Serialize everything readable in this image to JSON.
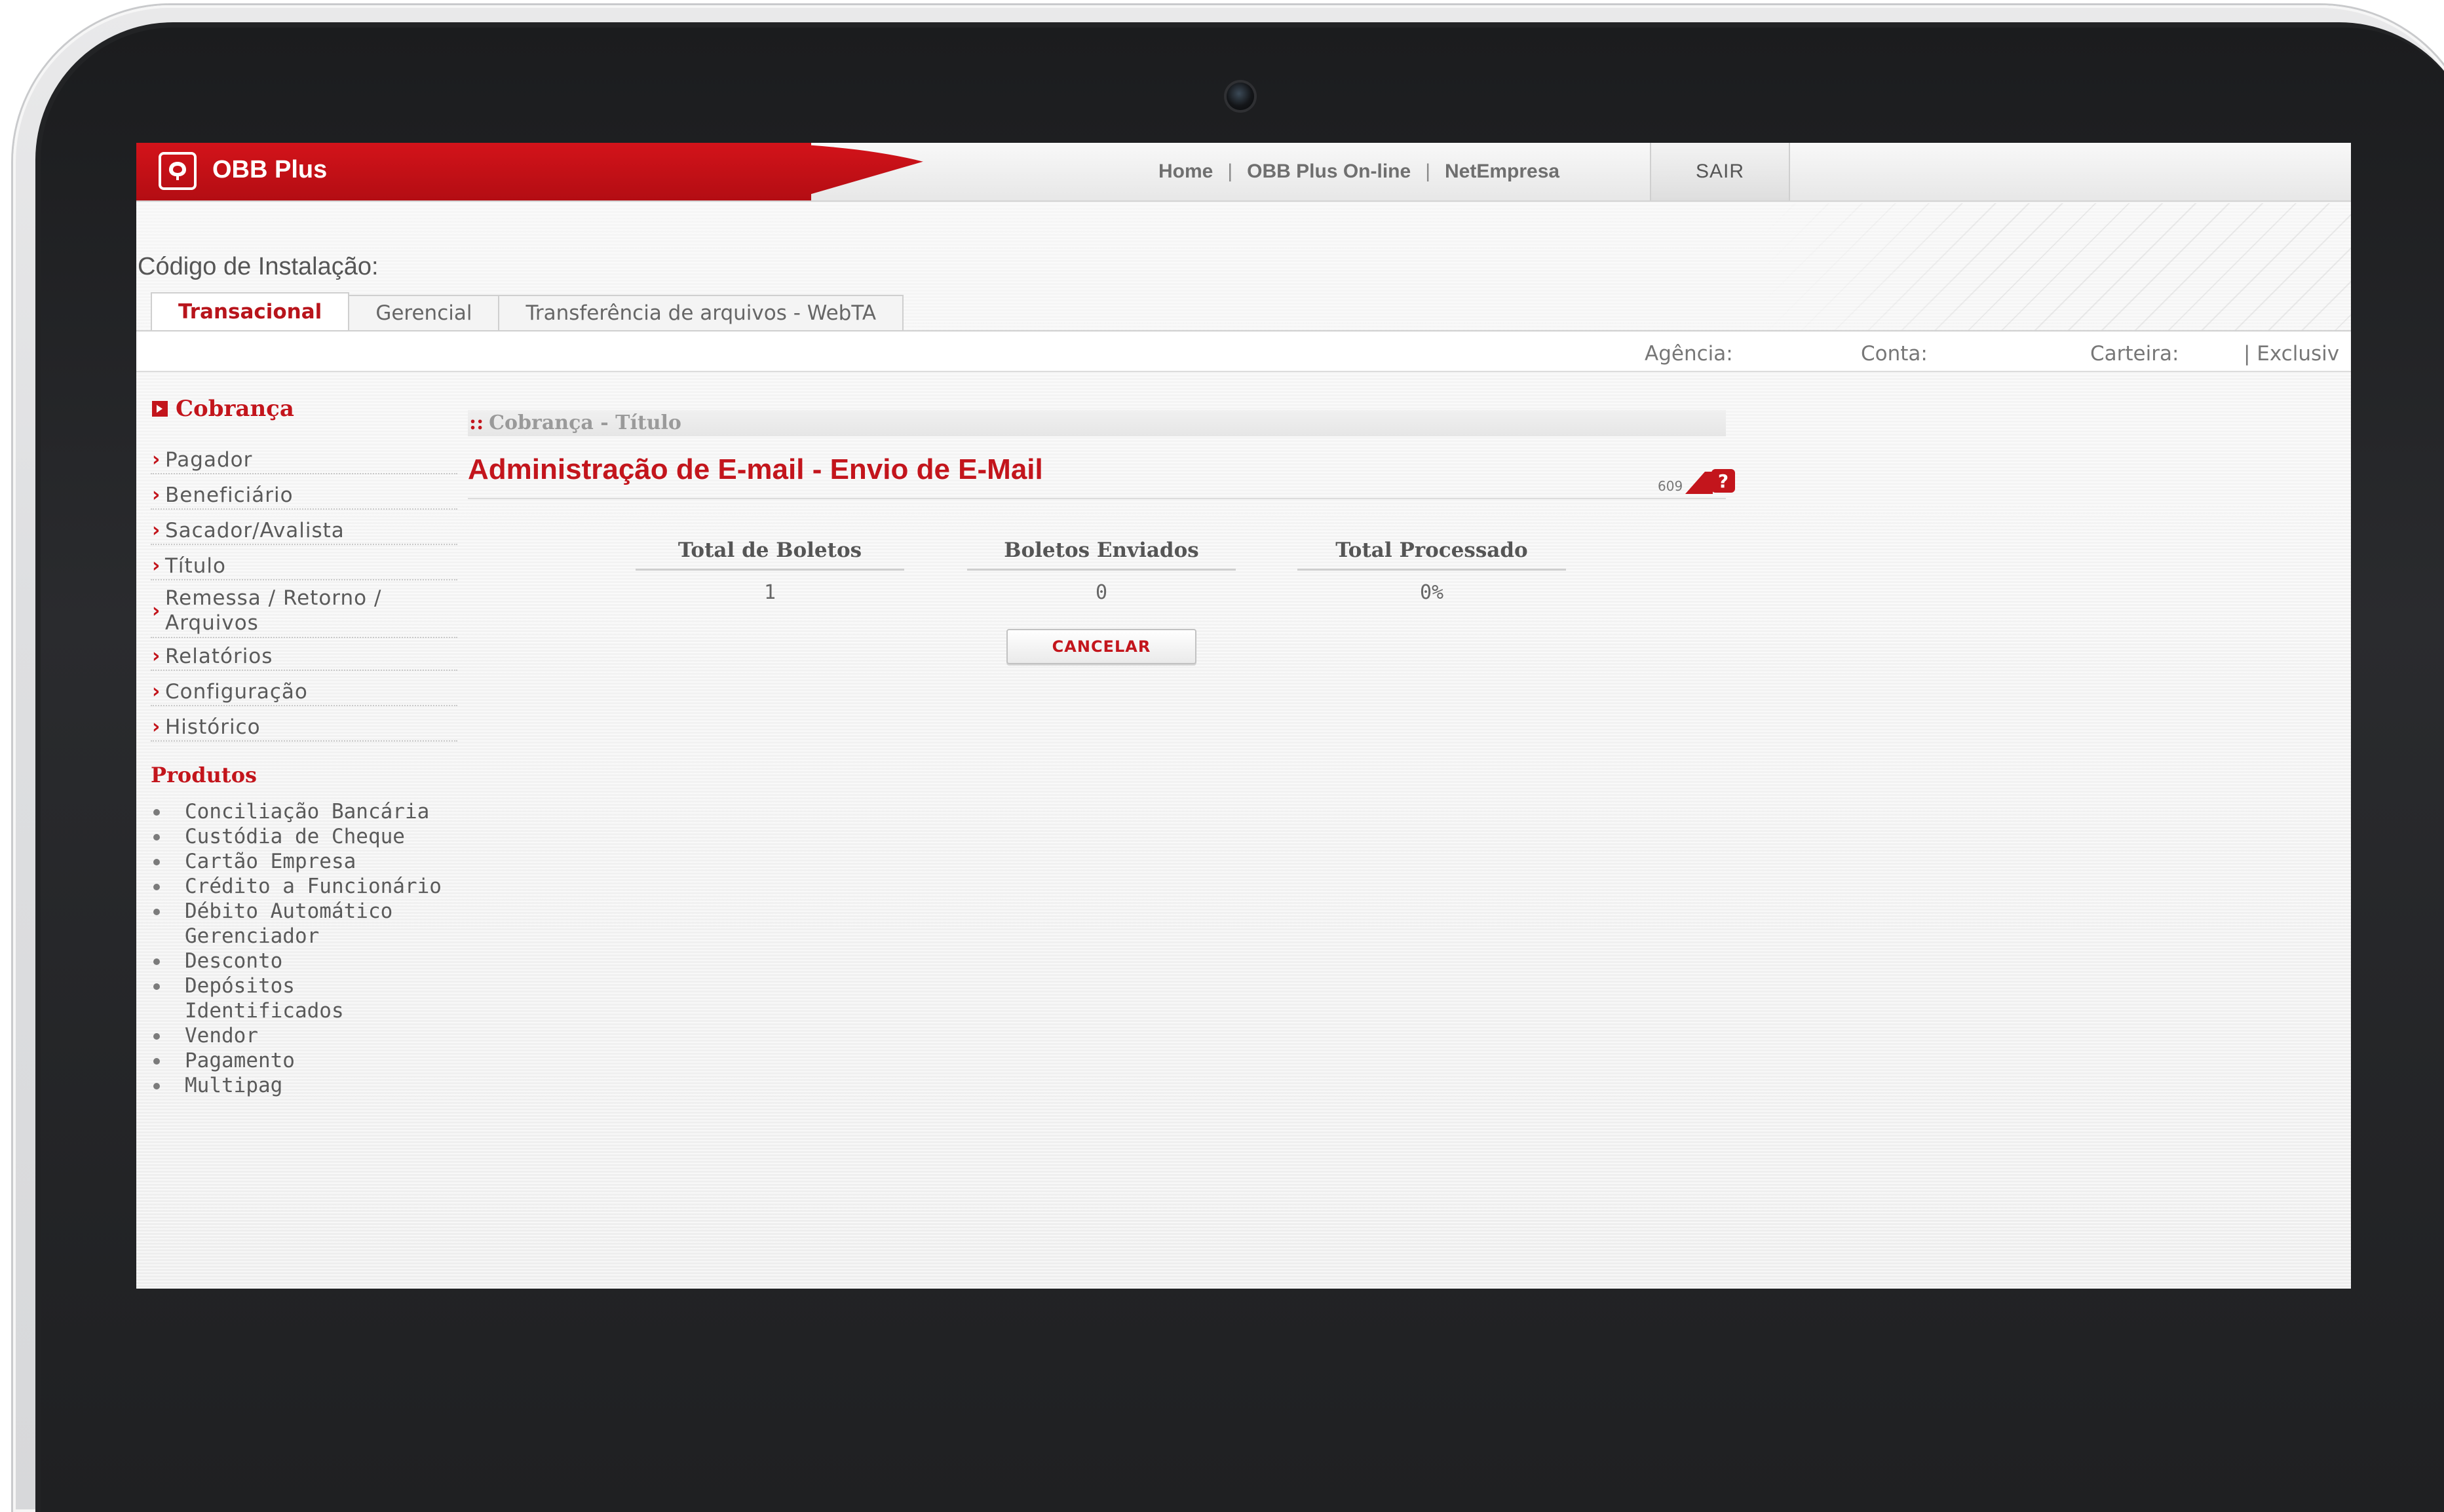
{
  "brand": {
    "name": "OBB Plus"
  },
  "topnav": {
    "items": [
      "Home",
      "OBB Plus On-line",
      "NetEmpresa"
    ],
    "separator": "|",
    "logout_label": "SAIR"
  },
  "install_code_label": "Código de Instalação:",
  "tabs": [
    {
      "label": "Transacional",
      "active": true
    },
    {
      "label": "Gerencial",
      "active": false
    },
    {
      "label": "Transferência de arquivos - WebTA",
      "active": false
    }
  ],
  "account_bar": {
    "agencia_label": "Agência:",
    "conta_label": "Conta:",
    "carteira_label": "Carteira:",
    "exclusiv_label": "| Exclusiv"
  },
  "sidebar": {
    "section_title": "Cobrança",
    "items": [
      {
        "label": "Pagador"
      },
      {
        "label": "Beneficiário"
      },
      {
        "label": "Sacador/Avalista"
      },
      {
        "label": "Título"
      },
      {
        "label": "Remessa / Retorno /",
        "label2": "Arquivos"
      },
      {
        "label": "Relatórios"
      },
      {
        "label": "Configuração"
      },
      {
        "label": "Histórico"
      }
    ],
    "products_title": "Produtos",
    "products": [
      "Conciliação Bancária",
      "Custódia de Cheque",
      "Cartão Empresa",
      "Crédito a Funcionário",
      "Débito Automático",
      "Gerenciador",
      "Desconto",
      "Depósitos",
      "Identificados",
      "Vendor",
      "Pagamento",
      "Multipag"
    ]
  },
  "main": {
    "breadcrumb_prefix": "::",
    "breadcrumb": "Cobrança - Título",
    "title": "Administração de E-mail - Envio de E-Mail",
    "help_code": "609",
    "stats": [
      {
        "header": "Total de Boletos",
        "value": "1"
      },
      {
        "header": "Boletos Enviados",
        "value": "0"
      },
      {
        "header": "Total Processado",
        "value": "0%"
      }
    ],
    "cancel_label": "CANCELAR"
  },
  "colors": {
    "accent": "#c3151c",
    "brand_red": "#d3131a"
  },
  "icons": {
    "logo": "obb-logo-icon",
    "help": "help-icon",
    "section_bullet": "arrow-square-icon",
    "nav_chevron": "chevron-right-icon"
  }
}
